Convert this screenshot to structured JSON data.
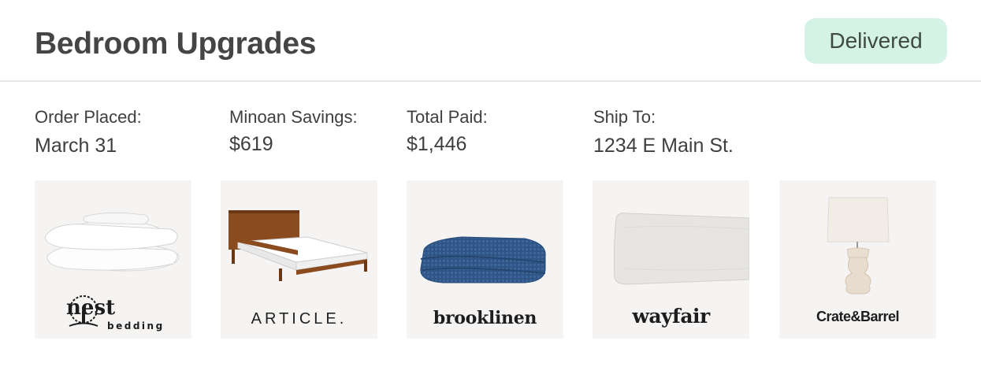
{
  "header": {
    "title": "Bedroom Upgrades",
    "status": "Delivered"
  },
  "colors": {
    "status_badge_bg": "#d4f3e6",
    "card_bg": "#f5f4f2",
    "text": "#3f3f3f"
  },
  "order_info": [
    {
      "label": "Order Placed:",
      "value": "March 31"
    },
    {
      "label": "Minoan Savings:",
      "value": "$619"
    },
    {
      "label": "Total Paid:",
      "value": "$1,446"
    },
    {
      "label": "Ship To:",
      "value": "1234 E Main St."
    }
  ],
  "products": [
    {
      "item": "pillows-icon",
      "brand": "nest",
      "brand_sub": "bedding"
    },
    {
      "item": "bed-frame-icon",
      "brand": "ARTICLE."
    },
    {
      "item": "blanket-icon",
      "brand": "brooklinen"
    },
    {
      "item": "body-pillow-icon",
      "brand": "wayfair"
    },
    {
      "item": "table-lamp-icon",
      "brand": "Crate&Barrel"
    }
  ]
}
